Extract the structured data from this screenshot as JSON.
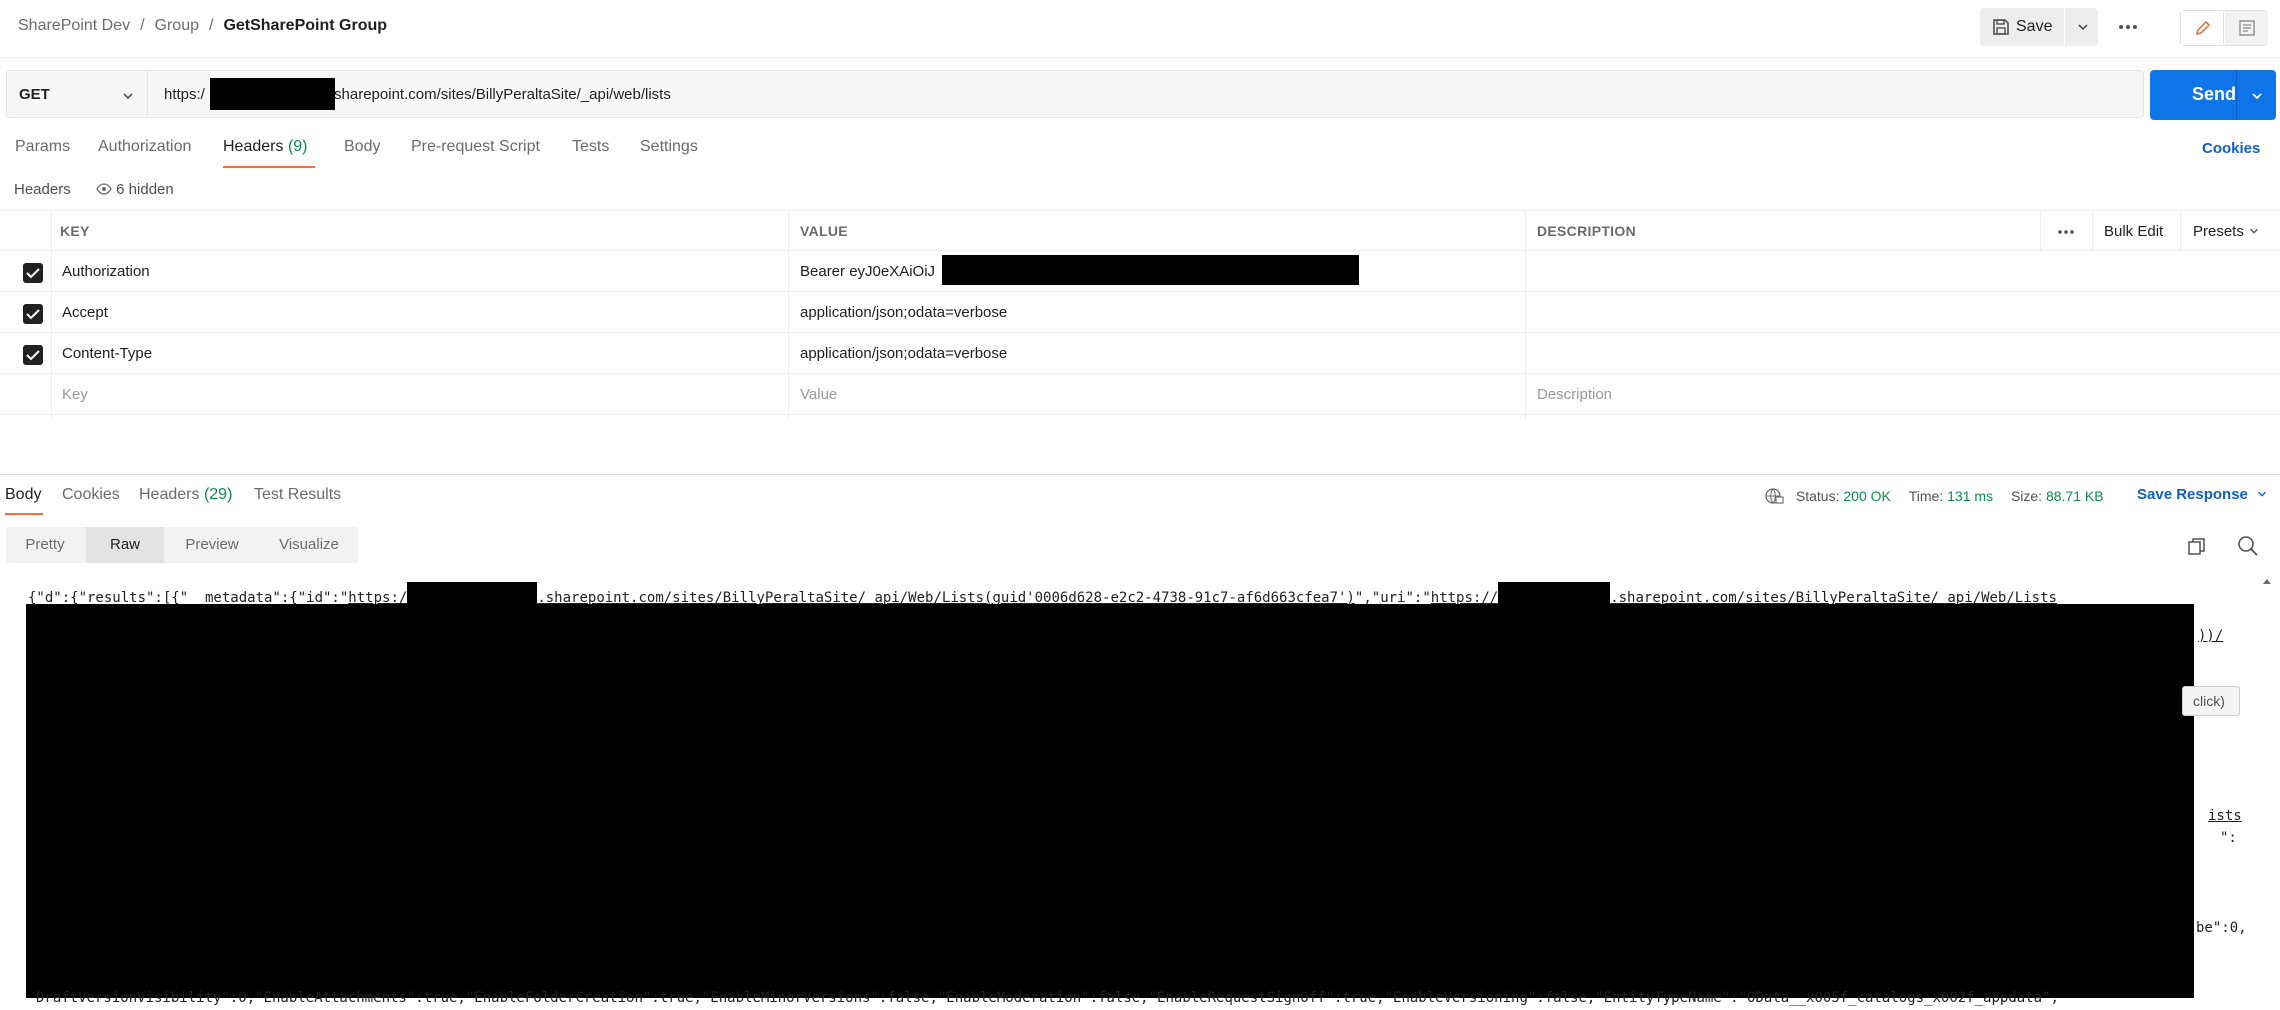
{
  "breadcrumb": {
    "items": [
      "SharePoint Dev",
      "Group"
    ],
    "current": "GetSharePoint Group",
    "separator": "/"
  },
  "toolbar": {
    "save_label": "Save",
    "more_icon": "ellipsis-icon",
    "mode_icons": [
      "pencil-icon",
      "document-icon"
    ]
  },
  "request": {
    "method": "GET",
    "url_prefix": "https:/",
    "url_suffix": ".sharepoint.com/sites/BillyPeraltaSite/_api/web/lists",
    "send_label": "Send"
  },
  "request_tabs": {
    "items": [
      {
        "label": "Params"
      },
      {
        "label": "Authorization"
      },
      {
        "label": "Headers",
        "count": "(9)"
      },
      {
        "label": "Body"
      },
      {
        "label": "Pre-request Script"
      },
      {
        "label": "Tests"
      },
      {
        "label": "Settings"
      }
    ],
    "active": "Headers",
    "cookies_label": "Cookies"
  },
  "headers_section": {
    "label": "Headers",
    "hidden_label": "6 hidden",
    "columns": {
      "key": "KEY",
      "value": "VALUE",
      "description": "DESCRIPTION"
    },
    "bulk_edit_label": "Bulk Edit",
    "presets_label": "Presets",
    "rows": [
      {
        "checked": true,
        "key": "Authorization",
        "value": "Bearer eyJ0eXAiOiJ"
      },
      {
        "checked": true,
        "key": "Accept",
        "value": "application/json;odata=verbose"
      },
      {
        "checked": true,
        "key": "Content-Type",
        "value": "application/json;odata=verbose"
      }
    ],
    "placeholders": {
      "key": "Key",
      "value": "Value",
      "description": "Description"
    }
  },
  "response": {
    "tabs": [
      {
        "label": "Body"
      },
      {
        "label": "Cookies"
      },
      {
        "label": "Headers",
        "count": "(29)"
      },
      {
        "label": "Test Results"
      }
    ],
    "active_tab": "Body",
    "status_label": "Status:",
    "status_value": "200 OK",
    "time_label": "Time:",
    "time_value": "131 ms",
    "size_label": "Size:",
    "size_value": "88.71 KB",
    "save_response_label": "Save Response",
    "view_tabs": [
      "Pretty",
      "Raw",
      "Preview",
      "Visualize"
    ],
    "active_view": "Raw",
    "body": {
      "line1_a": "{\"d\":{\"results\":[{\"__metadata\":{\"id\":\"",
      "line1_b": "https:/",
      "line1_c": ".sharepoint.com/sites/BillyPeraltaSite/_api/Web/Lists(guid'0006d628-e2c2-4738-91c7-af6d663cfea7')",
      "line1_d": "\",\"uri\":\"",
      "line1_e": "https://",
      "line1_f": ".sharepoint.com/sites/BillyPeraltaSite/_api/Web/Lists",
      "frag_1": "))/",
      "frag_2": "click)",
      "frag_3": "ists",
      "frag_4": "\":",
      "frag_5": "be\":0,",
      "last_line": "DraftVersionVisibility\":0,\"EnableAttachments\":true,\"EnableFolderCreation\":true,\"EnableMinorVersions\":false,\"EnableModeration\":false,\"EnableRequestSignOff\":true,\"EnableVersioning\":false,\"EntityTypeName\":\"OData__x005f_catalogs_x002f_appdata\","
    }
  },
  "colors": {
    "accent": "#ff6c37",
    "send": "#0f74e8",
    "link": "#0f5fc4",
    "ok": "#0e8a4b"
  }
}
